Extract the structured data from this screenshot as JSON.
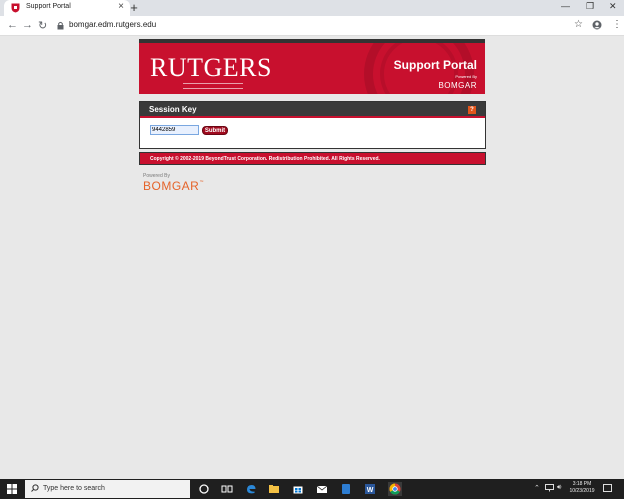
{
  "browser": {
    "tab_title": "Support Portal",
    "tab_close": "×",
    "new_tab": "+",
    "url": "bomgar.edm.rutgers.edu",
    "win_min": "—",
    "win_max": "❐",
    "win_close": "✕"
  },
  "banner": {
    "logo_text": "RUTGERS",
    "title": "Support Portal",
    "powered_by": "Powered By",
    "bomgar": "BOMGAR"
  },
  "session": {
    "title": "Session Key",
    "help": "?",
    "key_value": "9442859",
    "submit_label": "Submit"
  },
  "footer": {
    "copyright": "Copyright © 2002-2019 BeyondTrust Corporation. Redistribution Prohibited. All Rights Reserved."
  },
  "bottom_logo": {
    "powered_by": "Powered By",
    "name": "BOMGAR",
    "tm": "™"
  },
  "taskbar": {
    "search_placeholder": "Type here to search",
    "time": "3:18 PM",
    "date": "10/23/2019"
  },
  "colors": {
    "rutgers_red": "#c8102e",
    "bomgar_orange": "#e5642a"
  }
}
